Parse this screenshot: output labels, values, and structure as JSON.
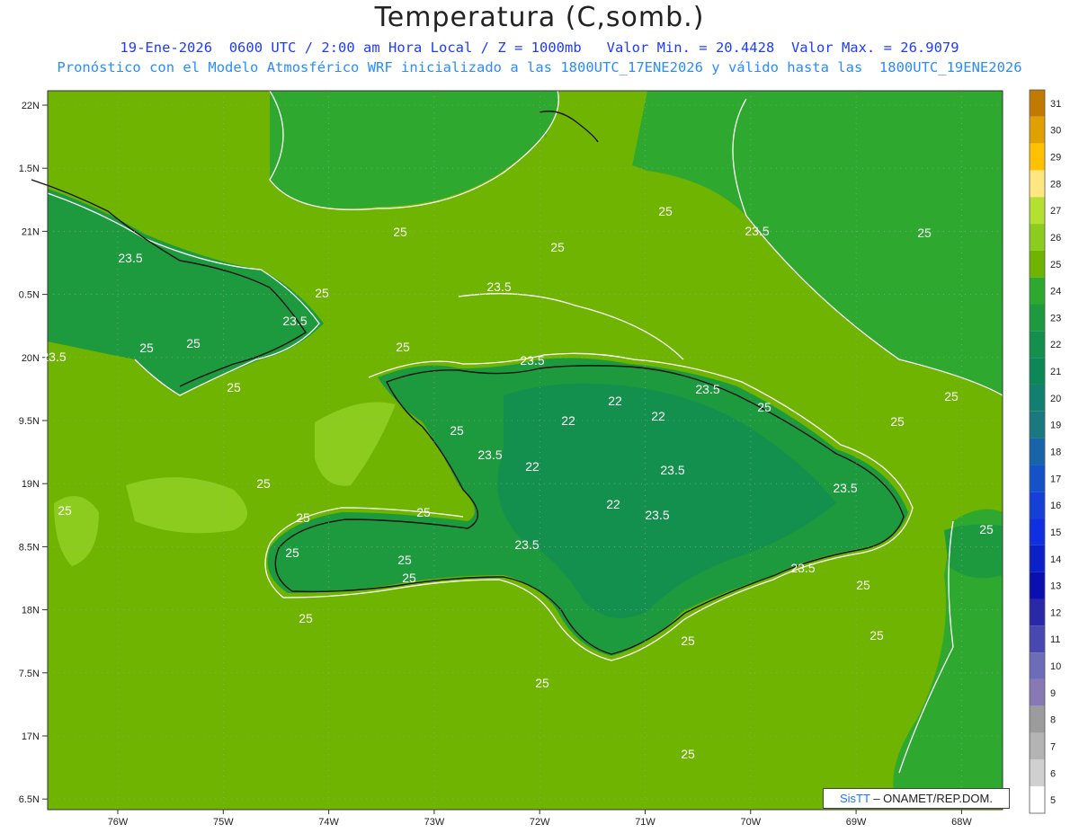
{
  "header": {
    "title": "Temperatura (C,somb.)",
    "line1": "19-Ene-2026  0600 UTC / 2:00 am Hora Local / Z = 1000mb   Valor Min. = 20.4428  Valor Max. = 26.9079",
    "line2": "Pronóstico con el Modelo Atmosférico WRF inicializado a las 1800UTC_17ENE2026 y válido hasta las  1800UTC_19ENE2026"
  },
  "axes": {
    "lat_labels": [
      "22N",
      "1.5N",
      "21N",
      "0.5N",
      "20N",
      "9.5N",
      "19N",
      "8.5N",
      "18N",
      "7.5N",
      "17N",
      "6.5N"
    ],
    "lon_labels": [
      "76W",
      "75W",
      "74W",
      "73W",
      "72W",
      "71W",
      "70W",
      "69W",
      "68W"
    ]
  },
  "colorbar": {
    "levels": [
      "31",
      "30",
      "29",
      "28",
      "27",
      "26",
      "25",
      "24",
      "23",
      "22",
      "21",
      "20",
      "19",
      "18",
      "17",
      "16",
      "15",
      "14",
      "13",
      "12",
      "11",
      "10",
      "9",
      "8",
      "7",
      "6",
      "5"
    ],
    "colors": [
      "#c07a00",
      "#e0a000",
      "#ffc000",
      "#ffe680",
      "#b4e032",
      "#8ccc1e",
      "#6eb400",
      "#2ea82e",
      "#1e9a3e",
      "#14904e",
      "#0c8858",
      "#128070",
      "#1a7880",
      "#1864a8",
      "#1452c8",
      "#1440d8",
      "#1030e0",
      "#0c20c8",
      "#0a10b0",
      "#2828a8",
      "#4848b0",
      "#6c6cb8",
      "#8878b4",
      "#9c9c9c",
      "#b4b4b4",
      "#d0d0d0",
      "#ffffff"
    ]
  },
  "map_labels": [
    "23.5",
    "25",
    "25",
    "25",
    "25",
    "25",
    "25",
    "23.5",
    "23.5",
    "23.5",
    "25",
    "25",
    "23.5",
    "22",
    "22",
    "22",
    "23.5",
    "22",
    "23.5",
    "23.5",
    "22",
    "23.5",
    "25",
    "25",
    "25",
    "25",
    "23.5",
    "23.5",
    "23.5",
    "25",
    "25",
    "25",
    "25",
    "25",
    "25",
    "25",
    "25",
    "23.5",
    "25",
    "25",
    "25",
    "25",
    "25",
    "25",
    "25"
  ],
  "credit": {
    "brand": "SisTT",
    "text": " – ONAMET/REP.DOM."
  }
}
